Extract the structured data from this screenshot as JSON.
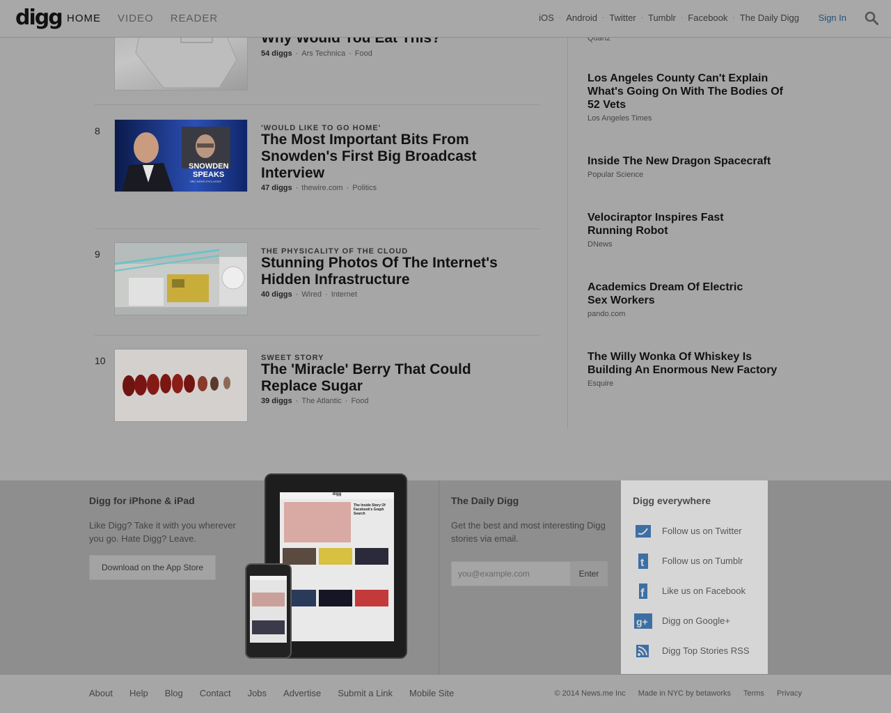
{
  "nav": {
    "logo": "digg",
    "main": [
      "HOME",
      "VIDEO",
      "READER"
    ],
    "right": [
      "iOS",
      "Android",
      "Twitter",
      "Tumblr",
      "Facebook",
      "The Daily Digg"
    ],
    "sep": "·",
    "signin": "Sign In",
    "search_icon": "search-icon"
  },
  "stories": [
    {
      "num": "",
      "kicker": "",
      "title": "Why Would You Eat This?",
      "diggs": "54 diggs",
      "source": "Ars Technica",
      "category": "Food"
    },
    {
      "num": "8",
      "kicker": "'Would Like To Go Home'",
      "title": "The Most Important Bits From Snowden's First Big Broadcast Interview",
      "diggs": "47 diggs",
      "source": "thewire.com",
      "category": "Politics",
      "thumb_text": [
        "SNOWDEN",
        "SPEAKS",
        "NBC NEWS EXCLUSIVE"
      ]
    },
    {
      "num": "9",
      "kicker": "The Physicality Of The Cloud",
      "title": "Stunning Photos Of The Internet's Hidden Infrastructure",
      "diggs": "40 diggs",
      "source": "Wired",
      "category": "Internet"
    },
    {
      "num": "10",
      "kicker": "Sweet Story",
      "title": "The 'Miracle' Berry That Could Replace Sugar",
      "diggs": "39 diggs",
      "source": "The Atlantic",
      "category": "Food"
    }
  ],
  "sidebar": [
    {
      "title": "",
      "source": "Quartz"
    },
    {
      "title": "Los Angeles County Can't Explain What's Going On With The Bodies Of 52 Vets",
      "source": "Los Angeles Times"
    },
    {
      "title": "Inside The New Dragon Spacecraft",
      "source": "Popular Science"
    },
    {
      "title": "Velociraptor Inspires Fast Running Robot",
      "source": "DNews"
    },
    {
      "title": "Academics Dream Of Electric Sex Workers",
      "source": "pando.com"
    },
    {
      "title": "The Willy Wonka Of Whiskey Is Building An Enormous New Factory",
      "source": "Esquire"
    }
  ],
  "promo": {
    "app": {
      "title": "Digg for iPhone & iPad",
      "text": "Like Digg? Take it with you wherever you go. Hate Digg? Leave.",
      "button": "Download on the App Store"
    },
    "daily": {
      "title": "The Daily Digg",
      "text": "Get the best and most interesting Digg stories via email.",
      "placeholder": "you@example.com",
      "button": "Enter"
    },
    "everywhere": {
      "title": "Digg everywhere",
      "items": [
        {
          "label": "Follow us on Twitter",
          "icon": "twitter-icon"
        },
        {
          "label": "Follow us on Tumblr",
          "icon": "tumblr-icon"
        },
        {
          "label": "Like us on Facebook",
          "icon": "facebook-icon"
        },
        {
          "label": "Digg on Google+",
          "icon": "google-plus-icon"
        },
        {
          "label": "Digg Top Stories RSS",
          "icon": "rss-icon"
        }
      ]
    },
    "device_screen": {
      "logo": "digg",
      "headline": "The Inside Story Of Facebook's Graph Search"
    }
  },
  "footer": {
    "links": [
      "About",
      "Help",
      "Blog",
      "Contact",
      "Jobs",
      "Advertise",
      "Submit a Link",
      "Mobile Site"
    ],
    "right": [
      "© 2014 News.me Inc",
      "Made in NYC by betaworks",
      "Terms",
      "Privacy"
    ]
  },
  "colors": {
    "accent_link": "#24527a",
    "icon_blue": "#3d6fa3",
    "overlay_bg": "#a6a6a6"
  }
}
